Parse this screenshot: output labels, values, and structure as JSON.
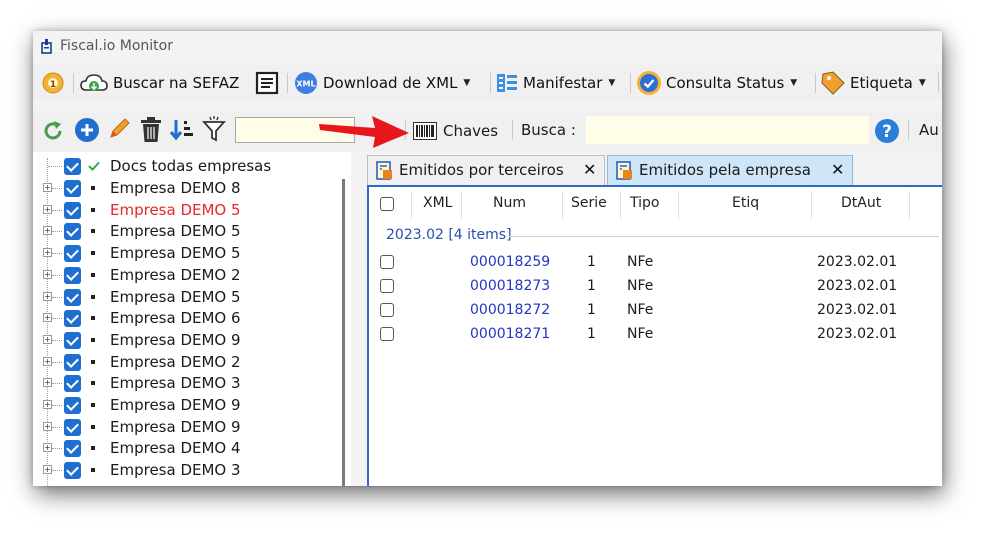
{
  "window": {
    "title": "Fiscal.io Monitor"
  },
  "toolbar": {
    "buscar_label": "Buscar na SEFAZ",
    "download_label": "Download de XML",
    "xml_icon_text": "XML",
    "manifestar_label": "Manifestar",
    "consulta_label": "Consulta Status",
    "etiqueta_label": "Etiqueta"
  },
  "toolbar2": {
    "chaves_label": "Chaves",
    "busca_label": "Busca :",
    "busca_value": "",
    "filter_value": "",
    "cutoff_label": "Au"
  },
  "tree": {
    "root_label": "Docs todas empresas",
    "items": [
      {
        "label": "Empresa DEMO 8",
        "color": "#1a1a1a"
      },
      {
        "label": "Empresa DEMO 5",
        "color": "#e8262b"
      },
      {
        "label": "Empresa DEMO 5",
        "color": "#1a1a1a"
      },
      {
        "label": "Empresa DEMO 5",
        "color": "#1a1a1a"
      },
      {
        "label": "Empresa DEMO 2",
        "color": "#1a1a1a"
      },
      {
        "label": "Empresa DEMO 5",
        "color": "#1a1a1a"
      },
      {
        "label": "Empresa DEMO 6",
        "color": "#1a1a1a"
      },
      {
        "label": "Empresa DEMO 9",
        "color": "#1a1a1a"
      },
      {
        "label": "Empresa DEMO 2",
        "color": "#1a1a1a"
      },
      {
        "label": "Empresa DEMO 3",
        "color": "#1a1a1a"
      },
      {
        "label": "Empresa DEMO 9",
        "color": "#1a1a1a"
      },
      {
        "label": "Empresa DEMO 9",
        "color": "#1a1a1a"
      },
      {
        "label": "Empresa DEMO 4",
        "color": "#1a1a1a"
      },
      {
        "label": "Empresa DEMO 3",
        "color": "#1a1a1a"
      }
    ]
  },
  "tabs": [
    {
      "label": "Emitidos por terceiros",
      "active": false
    },
    {
      "label": "Emitidos pela empresa",
      "active": true
    }
  ],
  "grid": {
    "columns": [
      "XML",
      "Num",
      "Serie",
      "Tipo",
      "Etiq",
      "DtAut"
    ],
    "group_label": "2023.02 [4 items]",
    "rows": [
      {
        "num": "000018259",
        "serie": "1",
        "tipo": "NFe",
        "dtaut": "2023.02.01"
      },
      {
        "num": "000018273",
        "serie": "1",
        "tipo": "NFe",
        "dtaut": "2023.02.01"
      },
      {
        "num": "000018272",
        "serie": "1",
        "tipo": "NFe",
        "dtaut": "2023.02.01"
      },
      {
        "num": "000018271",
        "serie": "1",
        "tipo": "NFe",
        "dtaut": "2023.02.01"
      }
    ]
  },
  "colors": {
    "accent_blue": "#1f6fd0",
    "link_blue": "#2433c7",
    "active_tab_bg": "#d4e8f8",
    "red_pointer": "#e8161b",
    "input_bg": "#fffde8"
  },
  "icons": {
    "titlebar": "app-logo-icon",
    "toolbar": [
      "settings-badge-icon",
      "cloud-download-icon",
      "document-list-icon",
      "xml-badge-icon",
      "manifest-icon",
      "check-status-icon",
      "tag-icon"
    ],
    "toolbar2": [
      "refresh-icon",
      "add-icon",
      "edit-pencil-icon",
      "trash-icon",
      "sort-icon",
      "filter-icon",
      "barcode-icon",
      "help-icon"
    ],
    "annotation": "red-arrow-icon"
  }
}
